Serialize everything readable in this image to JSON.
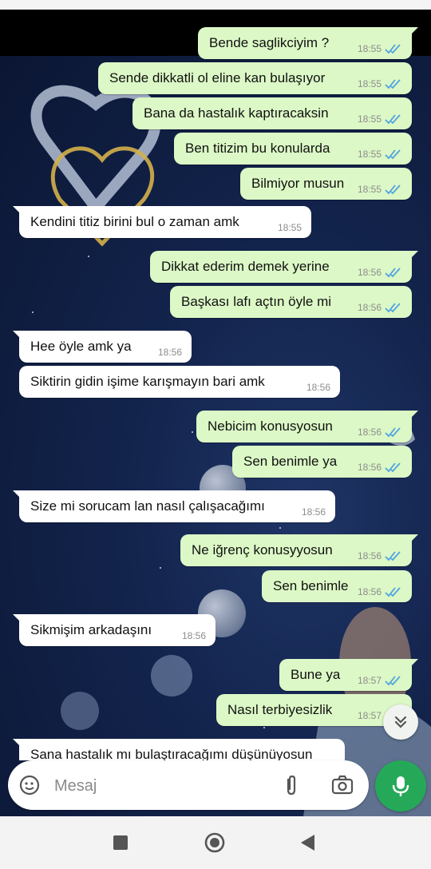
{
  "chat": {
    "messages": [
      {
        "dir": "out",
        "text": "Bende saglikciyim ?",
        "time": "18:55",
        "read": true
      },
      {
        "dir": "out",
        "text": "Sende dikkatli ol eline kan bulaşıyor",
        "time": "18:55",
        "read": true
      },
      {
        "dir": "out",
        "text": "Bana da hastalık kaptıracaksin",
        "time": "18:55",
        "read": true
      },
      {
        "dir": "out",
        "text": "Ben titizim bu konularda",
        "time": "18:55",
        "read": true
      },
      {
        "dir": "out",
        "text": "Bilmiyor musun",
        "time": "18:55",
        "read": true
      },
      {
        "dir": "in",
        "text": "Kendini titiz birini bul o zaman amk",
        "time": "18:55"
      },
      {
        "dir": "out",
        "text": "Dikkat ederim demek yerine",
        "time": "18:56",
        "read": true
      },
      {
        "dir": "out",
        "text": "Başkası lafı açtın öyle mi",
        "time": "18:56",
        "read": true
      },
      {
        "dir": "in",
        "text": "Hee öyle amk ya",
        "time": "18:56"
      },
      {
        "dir": "in",
        "text": "Siktirin gidin işime karışmayın bari amk",
        "time": "18:56"
      },
      {
        "dir": "out",
        "text": "Nebicim konusyosun",
        "time": "18:56",
        "read": true
      },
      {
        "dir": "out",
        "text": "Sen benimle ya",
        "time": "18:56",
        "read": true
      },
      {
        "dir": "in",
        "text": "Size mi sorucam lan nasıl çalışacağımı",
        "time": "18:56"
      },
      {
        "dir": "out",
        "text": "Ne iğrenç konusyyosun",
        "time": "18:56",
        "read": true
      },
      {
        "dir": "out",
        "text": "Sen benimle",
        "time": "18:56",
        "read": true
      },
      {
        "dir": "in",
        "text": "Sikmişim arkadaşını",
        "time": "18:56"
      },
      {
        "dir": "out",
        "text": "Bune ya",
        "time": "18:57",
        "read": true
      },
      {
        "dir": "out",
        "text": "Nasıl terbiyesizlik",
        "time": "18:57",
        "read": true
      },
      {
        "dir": "in",
        "text": "Sana hastalık mı bulaştıracağımı düşünüyosun",
        "time": ""
      }
    ]
  },
  "input": {
    "placeholder": "Mesaj"
  },
  "icons": {
    "emoji": "sticker-icon",
    "attach": "paperclip-icon",
    "camera": "camera-icon",
    "mic": "microphone-icon",
    "scroll": "double-chevron-down-icon",
    "nav_recent": "square-icon",
    "nav_home": "circle-icon",
    "nav_back": "triangle-back-icon"
  },
  "colors": {
    "outgoing": "#dcf8c6",
    "incoming": "#ffffff",
    "mic": "#25a959",
    "read_ticks": "#4fa3e0"
  }
}
